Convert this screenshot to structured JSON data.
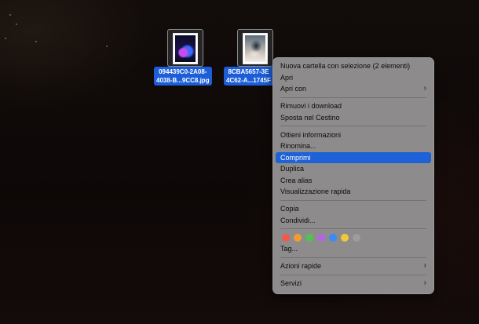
{
  "files": [
    {
      "label_line1": "094439C0-2A08-",
      "label_line2": "4038-B...9CC8.jpg"
    },
    {
      "label_line1": "8CBA5657-3E",
      "label_line2": "4C62-A...1745F"
    }
  ],
  "context_menu": {
    "groups": [
      [
        {
          "label": "Nuova cartella con selezione (2 elementi)"
        },
        {
          "label": "Apri"
        },
        {
          "label": "Apri con",
          "submenu": true
        }
      ],
      [
        {
          "label": "Rimuovi i download"
        },
        {
          "label": "Sposta nel Cestino"
        }
      ],
      [
        {
          "label": "Ottieni informazioni"
        },
        {
          "label": "Rinomina..."
        },
        {
          "label": "Comprimi",
          "highlighted": true
        },
        {
          "label": "Duplica"
        },
        {
          "label": "Crea alias"
        },
        {
          "label": "Visualizzazione rapida"
        }
      ],
      [
        {
          "label": "Copia"
        },
        {
          "label": "Condividi..."
        }
      ]
    ],
    "tag_colors": [
      {
        "name": "red-tag",
        "color": "#f05a4d"
      },
      {
        "name": "orange-tag",
        "color": "#f39a33"
      },
      {
        "name": "green-tag",
        "color": "#4fc253"
      },
      {
        "name": "purple-tag",
        "color": "#b066e0"
      },
      {
        "name": "blue-tag",
        "color": "#3a8cf4"
      },
      {
        "name": "yellow-tag",
        "color": "#f1c936"
      },
      {
        "name": "gray-tag",
        "color": "#9d9d9d"
      }
    ],
    "tags_label": "Tag...",
    "quick_actions_label": "Azioni rapide",
    "services_label": "Servizi",
    "chevron_icon": "chevron-right-icon"
  }
}
